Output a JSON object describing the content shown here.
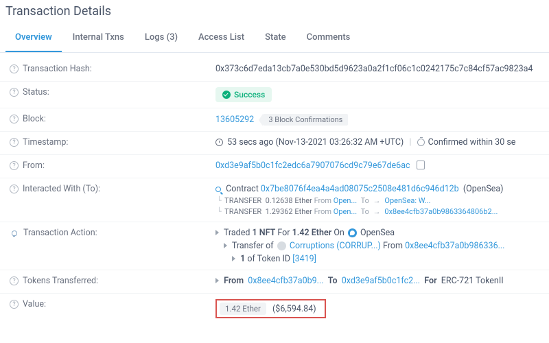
{
  "page_title": "Transaction Details",
  "tabs": {
    "overview": "Overview",
    "internal": "Internal Txns",
    "logs": "Logs (3)",
    "access": "Access List",
    "state": "State",
    "comments": "Comments"
  },
  "labels": {
    "hash": "Transaction Hash:",
    "status": "Status:",
    "block": "Block:",
    "timestamp": "Timestamp:",
    "from": "From:",
    "to": "Interacted With (To):",
    "action": "Transaction Action:",
    "tokens": "Tokens Transferred:",
    "value": "Value:"
  },
  "hash": "0x373c6d7eda13cb7a0e530bd5d9623a0a2f1cf06c1c0242175c7c84cf57ac9823a4",
  "status_text": "Success",
  "block": {
    "number": "13605292",
    "confirmations": "3 Block Confirmations"
  },
  "timestamp": {
    "relative": "53 secs ago",
    "absolute": "(Nov-13-2021 03:26:32 AM +UTC)",
    "confirmed": "Confirmed within 30 se"
  },
  "from_addr": "0xd3e9af5b0c1fc2edc6a7907076cd9c79e67de6ac",
  "to": {
    "prefix": "Contract",
    "addr": "0x7be8076f4ea4a4ad08075c2508e481d6c946d12b",
    "name": "(OpenSea)",
    "t1_label": "TRANSFER",
    "t1_amount": "0.12638 Ether",
    "t1_from_word": "From",
    "t1_from": "Open...",
    "t1_to_word": "To",
    "t1_to": "OpenSea: W...",
    "t2_amount": "1.29362 Ether",
    "t2_to": "0x8ee4cfb37a0b9863364806b2..."
  },
  "action": {
    "line1_a": "Traded",
    "line1_b": "1 NFT",
    "line1_c": "For",
    "line1_d": "1.42 Ether",
    "line1_e": "On",
    "line1_f": "OpenSea",
    "line2_a": "Transfer of",
    "line2_b": "Corruptions (CORRUP...)",
    "line2_c": "From",
    "line2_d": "0x8ee4cfb37a0b986336...",
    "line3_a": "1",
    "line3_b": "of Token ID",
    "line3_c": "[3419]"
  },
  "tokens": {
    "from_word": "From",
    "from": "0x8ee4cfb37a0b9...",
    "to_word": "To",
    "to": "0xd3e9af5b0c1fc2...",
    "for_word": "For",
    "for": "ERC-721 TokenII"
  },
  "value": {
    "ether": "1.42 Ether",
    "usd": "($6,594.84)"
  }
}
